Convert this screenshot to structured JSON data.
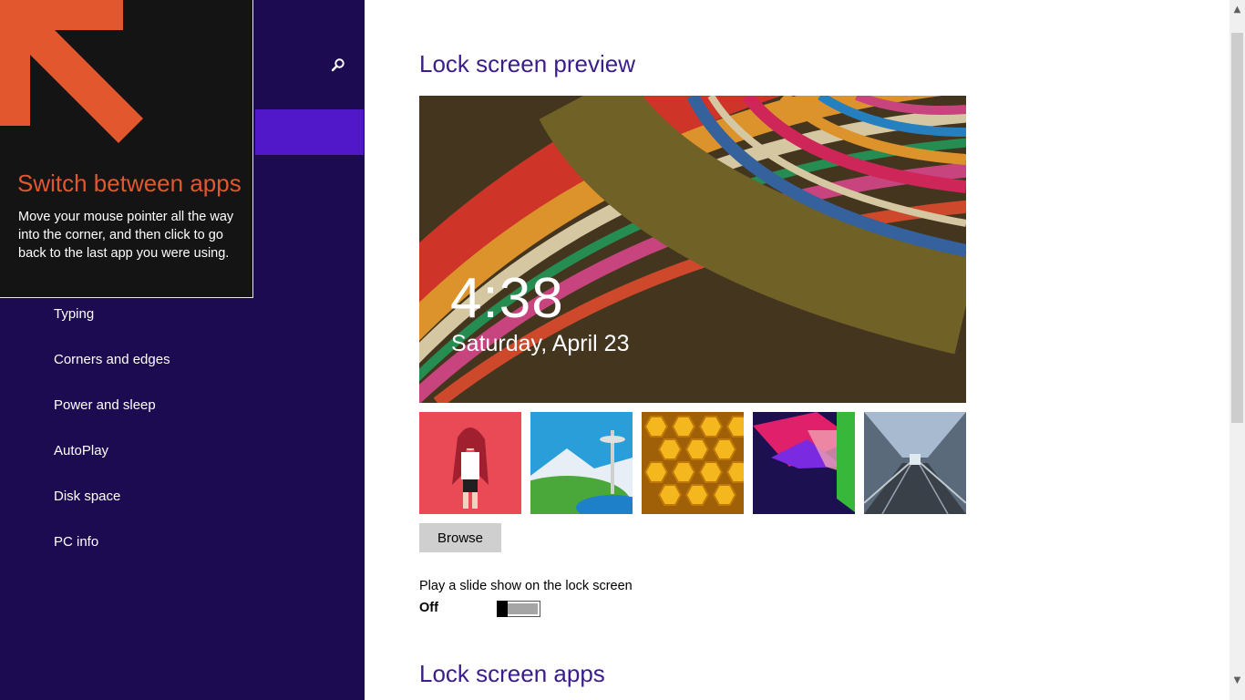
{
  "tip": {
    "title": "Switch between apps",
    "body": "Move your mouse pointer all the way into the corner, and then click to go back to the last app you were using."
  },
  "sidebar": {
    "items": [
      {
        "label": "Typing"
      },
      {
        "label": "Corners and edges"
      },
      {
        "label": "Power and sleep"
      },
      {
        "label": "AutoPlay"
      },
      {
        "label": "Disk space"
      },
      {
        "label": "PC info"
      }
    ]
  },
  "main": {
    "preview_title": "Lock screen preview",
    "clock": "4:38",
    "date": "Saturday, April 23",
    "browse_label": "Browse",
    "slideshow_label": "Play a slide show on the lock screen",
    "slideshow_state": "Off",
    "apps_title": "Lock screen apps"
  },
  "colors": {
    "sidebar_bg": "#1d0b52",
    "accent": "#5018c9",
    "tip_title": "#e2572e",
    "section_title": "#3b1d8a"
  }
}
